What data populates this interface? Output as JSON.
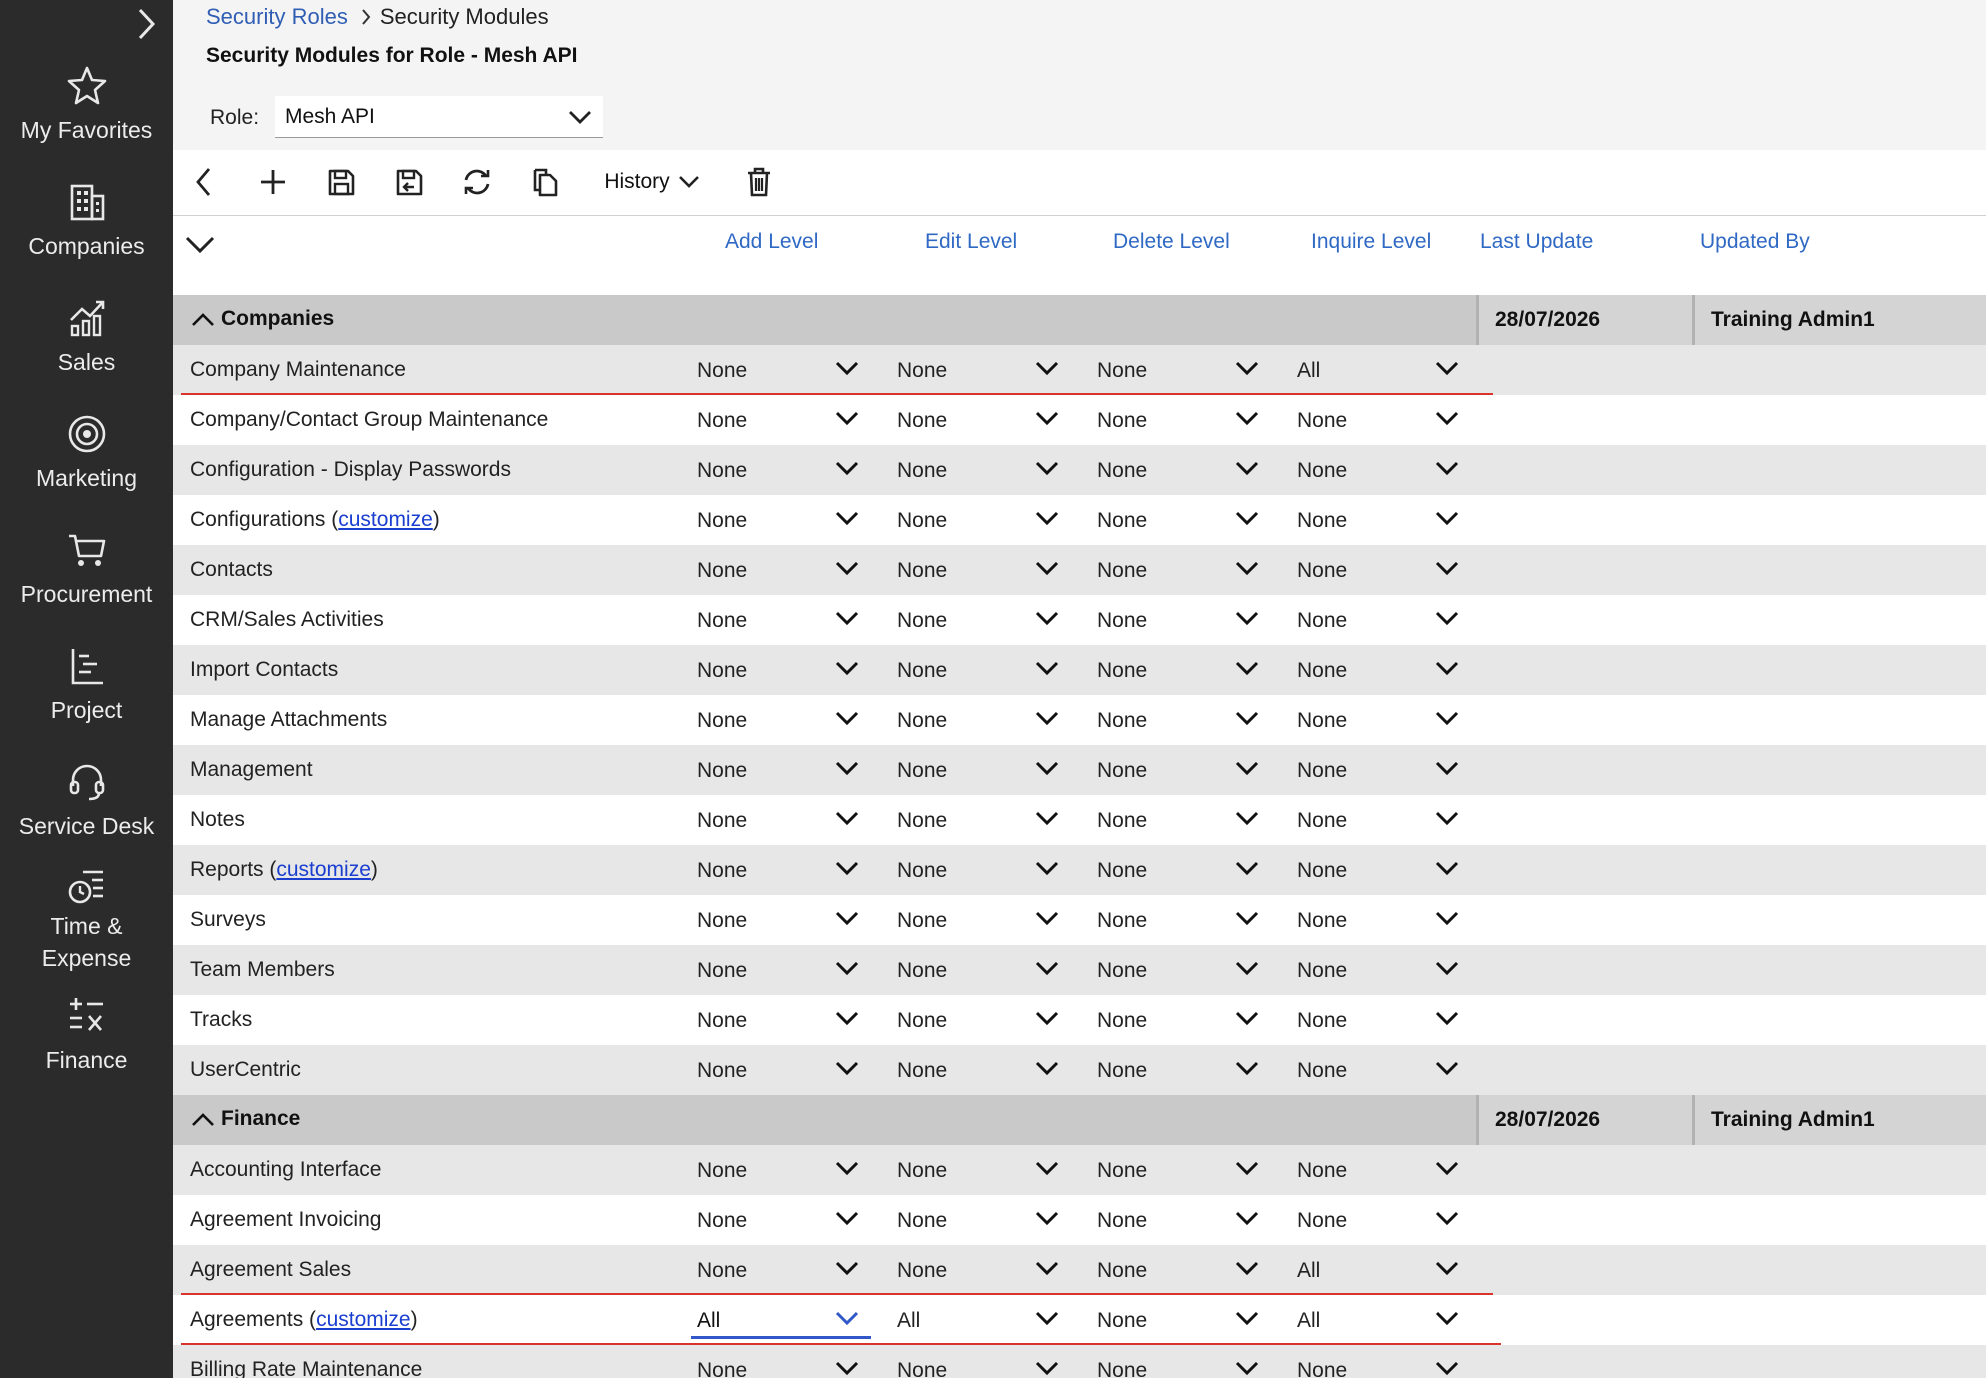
{
  "sidebar": {
    "items": [
      {
        "label": "My Favorites",
        "icon": "star-icon"
      },
      {
        "label": "Companies",
        "icon": "building-icon"
      },
      {
        "label": "Sales",
        "icon": "chart-icon"
      },
      {
        "label": "Marketing",
        "icon": "target-icon"
      },
      {
        "label": "Procurement",
        "icon": "cart-icon"
      },
      {
        "label": "Project",
        "icon": "project-icon"
      },
      {
        "label": "Service Desk",
        "icon": "headset-icon"
      },
      {
        "label": "Time &",
        "label2": "Expense",
        "icon": "time-expense-icon"
      },
      {
        "label": "Finance",
        "icon": "finance-icon"
      }
    ]
  },
  "breadcrumb": {
    "parent": "Security Roles",
    "current": "Security Modules"
  },
  "page_title": "Security Modules for Role - Mesh API",
  "role": {
    "label": "Role:",
    "value": "Mesh API"
  },
  "toolbar": {
    "history_label": "History"
  },
  "columns": {
    "add": "Add Level",
    "edit": "Edit Level",
    "delete": "Delete Level",
    "inquire": "Inquire Level",
    "last_update": "Last Update",
    "updated_by": "Updated By"
  },
  "groups": [
    {
      "title": "Companies",
      "last_update": "28/07/2026",
      "updated_by": "Training Admin1",
      "rows": [
        {
          "name": "Company Maintenance",
          "add": "None",
          "edit": "None",
          "delete": "None",
          "inquire": "All",
          "changed": true
        },
        {
          "name": "Company/Contact Group Maintenance",
          "add": "None",
          "edit": "None",
          "delete": "None",
          "inquire": "None"
        },
        {
          "name": "Configuration - Display Passwords",
          "add": "None",
          "edit": "None",
          "delete": "None",
          "inquire": "None"
        },
        {
          "name": "Configurations (",
          "link": "customize",
          "suffix": ")",
          "add": "None",
          "edit": "None",
          "delete": "None",
          "inquire": "None"
        },
        {
          "name": "Contacts",
          "add": "None",
          "edit": "None",
          "delete": "None",
          "inquire": "None"
        },
        {
          "name": "CRM/Sales Activities",
          "add": "None",
          "edit": "None",
          "delete": "None",
          "inquire": "None"
        },
        {
          "name": "Import Contacts",
          "add": "None",
          "edit": "None",
          "delete": "None",
          "inquire": "None"
        },
        {
          "name": "Manage Attachments",
          "add": "None",
          "edit": "None",
          "delete": "None",
          "inquire": "None"
        },
        {
          "name": "Management",
          "add": "None",
          "edit": "None",
          "delete": "None",
          "inquire": "None"
        },
        {
          "name": "Notes",
          "add": "None",
          "edit": "None",
          "delete": "None",
          "inquire": "None"
        },
        {
          "name": "Reports (",
          "link": "customize",
          "suffix": ")",
          "add": "None",
          "edit": "None",
          "delete": "None",
          "inquire": "None"
        },
        {
          "name": "Surveys",
          "add": "None",
          "edit": "None",
          "delete": "None",
          "inquire": "None"
        },
        {
          "name": "Team Members",
          "add": "None",
          "edit": "None",
          "delete": "None",
          "inquire": "None"
        },
        {
          "name": "Tracks",
          "add": "None",
          "edit": "None",
          "delete": "None",
          "inquire": "None"
        },
        {
          "name": "UserCentric",
          "add": "None",
          "edit": "None",
          "delete": "None",
          "inquire": "None"
        }
      ]
    },
    {
      "title": "Finance",
      "last_update": "28/07/2026",
      "updated_by": "Training Admin1",
      "rows": [
        {
          "name": "Accounting Interface",
          "add": "None",
          "edit": "None",
          "delete": "None",
          "inquire": "None"
        },
        {
          "name": "Agreement Invoicing",
          "add": "None",
          "edit": "None",
          "delete": "None",
          "inquire": "None"
        },
        {
          "name": "Agreement Sales",
          "add": "None",
          "edit": "None",
          "delete": "None",
          "inquire": "All",
          "changed": true
        },
        {
          "name": "Agreements (",
          "link": "customize",
          "suffix": ")",
          "add": "All",
          "edit": "All",
          "delete": "None",
          "inquire": "All",
          "changed": true,
          "focused": "add"
        },
        {
          "name": "Billing Rate Maintenance",
          "add": "None",
          "edit": "None",
          "delete": "None",
          "inquire": "None"
        }
      ]
    }
  ],
  "colors": {
    "sidebar_bg": "#2b2b2b",
    "link_blue": "#2f69c4",
    "changed_underline": "#d9342b",
    "group_bg": "#c9c9c9",
    "alt_row_bg": "#e7e7e7"
  }
}
